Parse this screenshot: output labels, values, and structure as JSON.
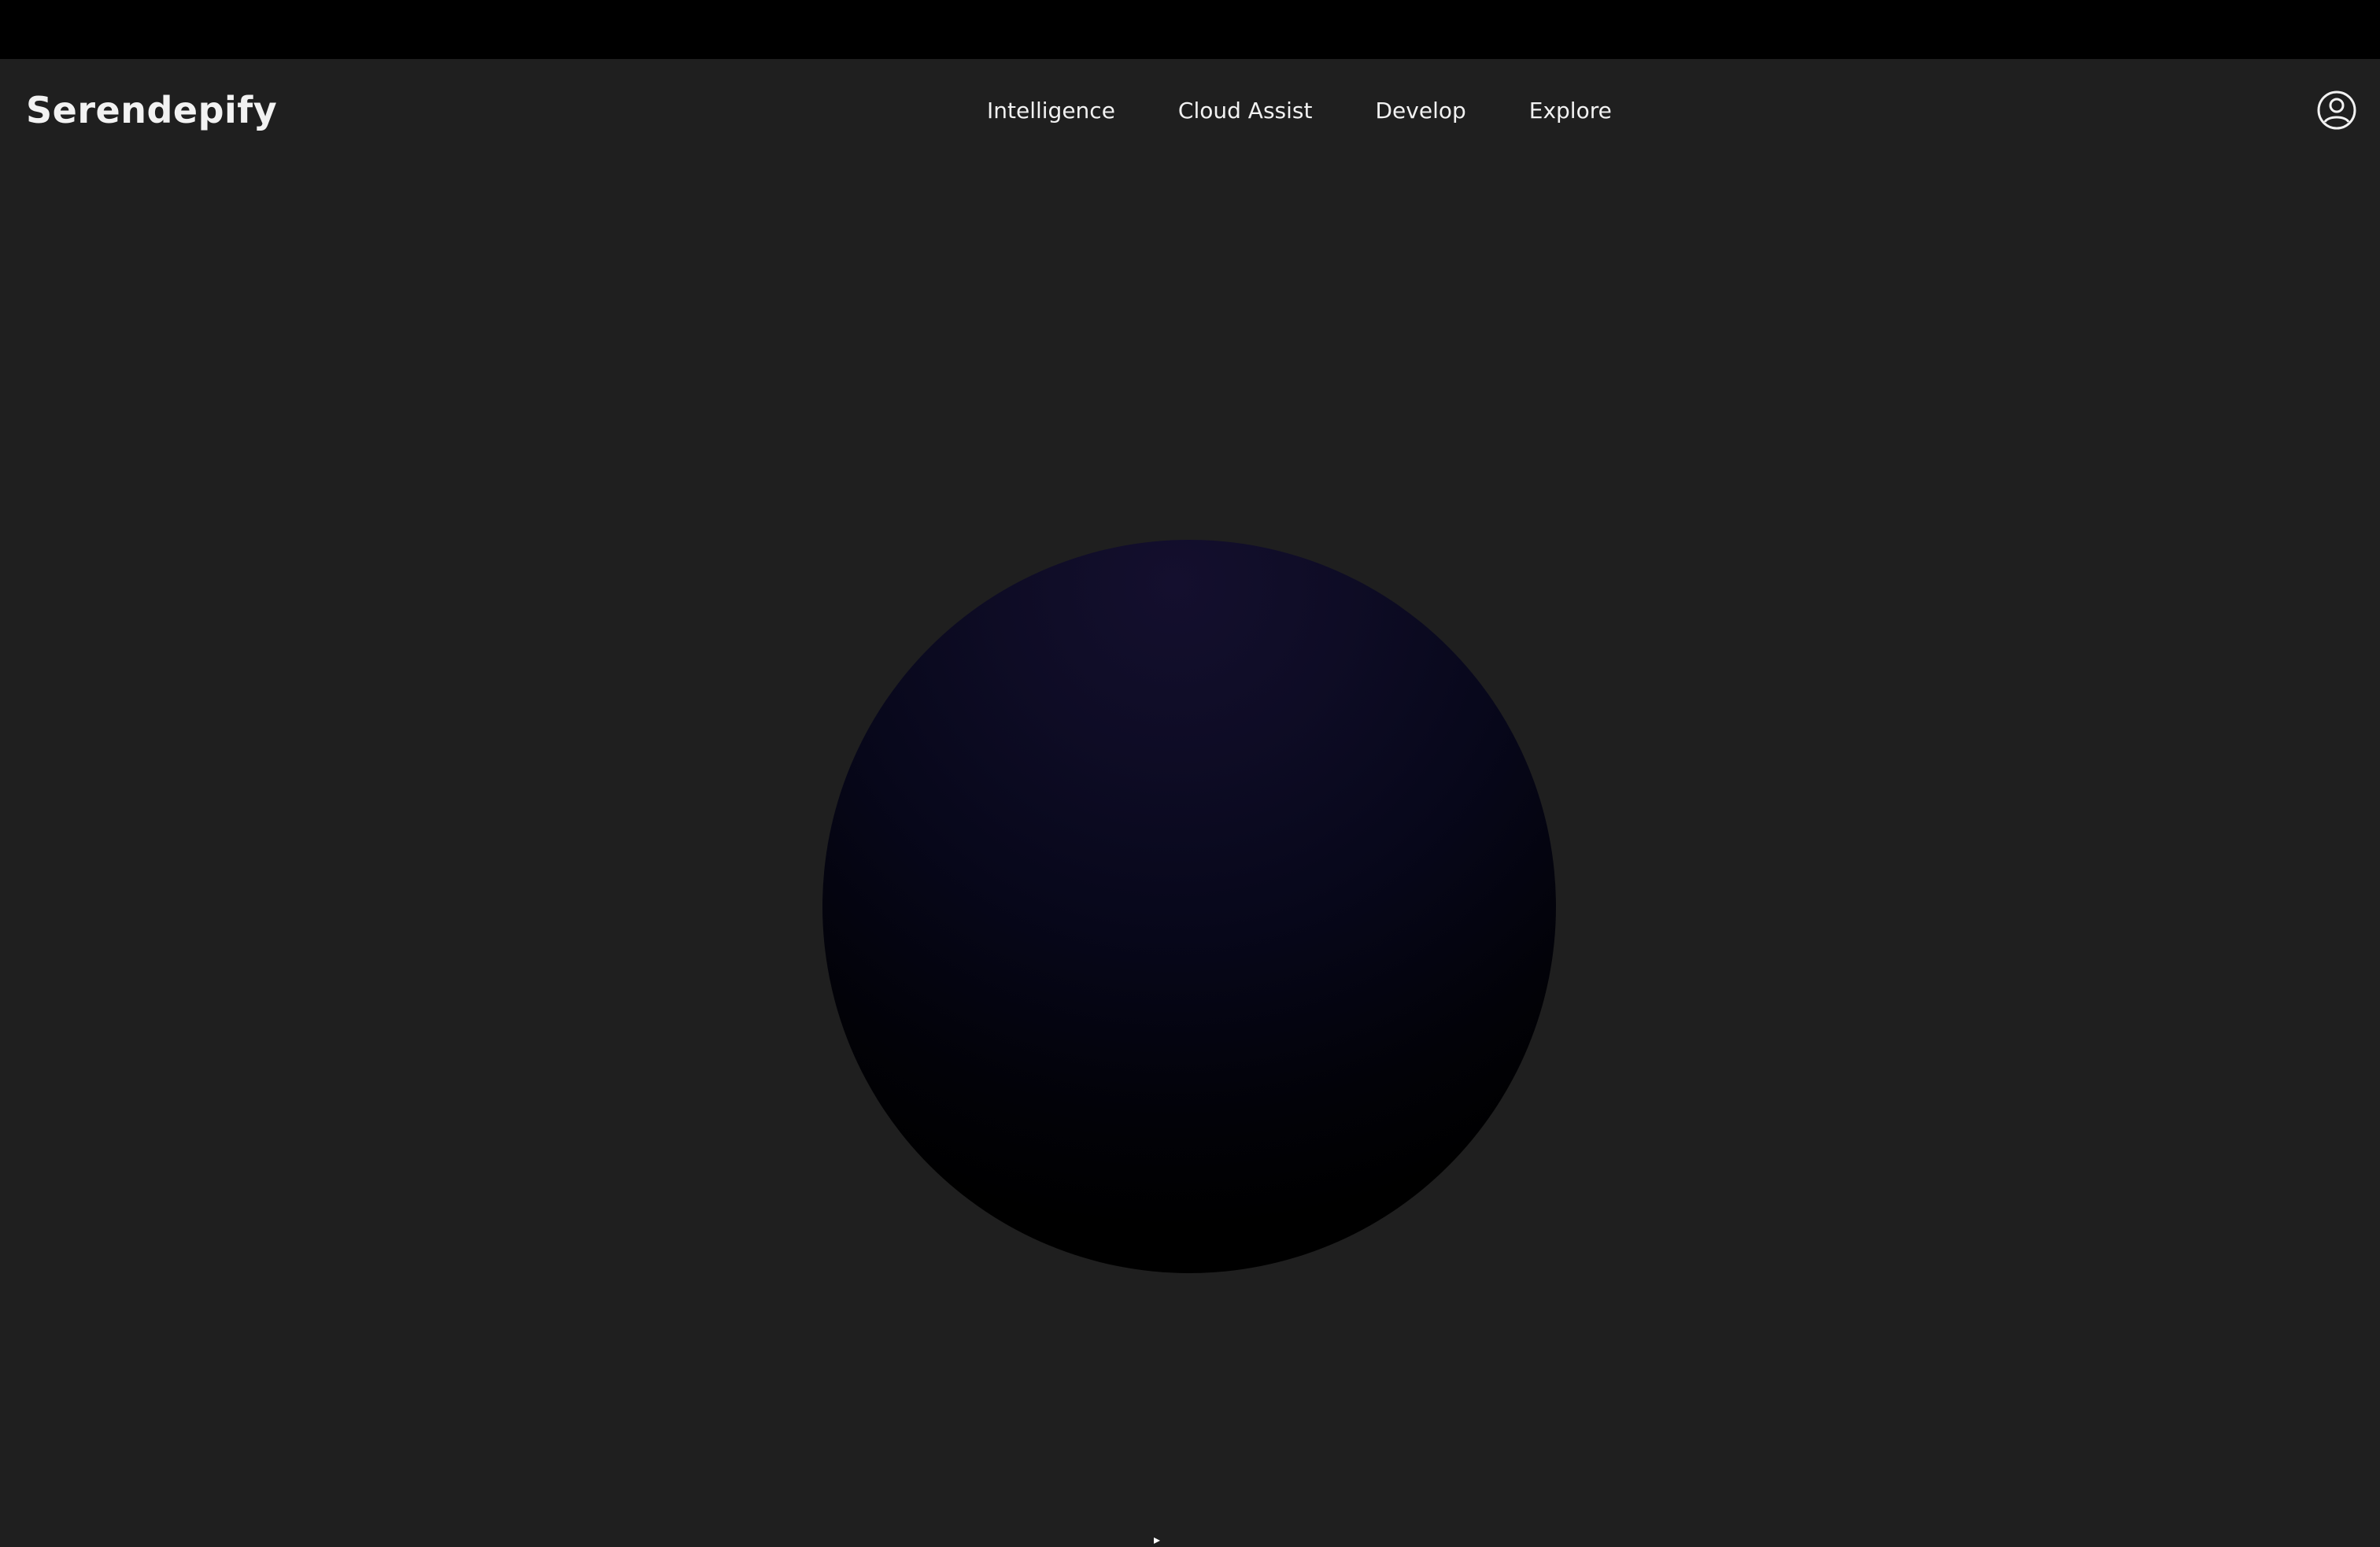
{
  "app": {
    "logo": "Serendepify"
  },
  "nav": {
    "items": [
      {
        "label": "Intelligence"
      },
      {
        "label": "Cloud Assist"
      },
      {
        "label": "Develop"
      },
      {
        "label": "Explore"
      }
    ]
  },
  "account": {
    "icon": "user-account-icon"
  },
  "colors": {
    "background": "#1f1f1f",
    "top_bar": "#000000",
    "text": "#f2f2f2",
    "orb_highlight": "#140f2e",
    "orb_shadow": "#000000"
  }
}
